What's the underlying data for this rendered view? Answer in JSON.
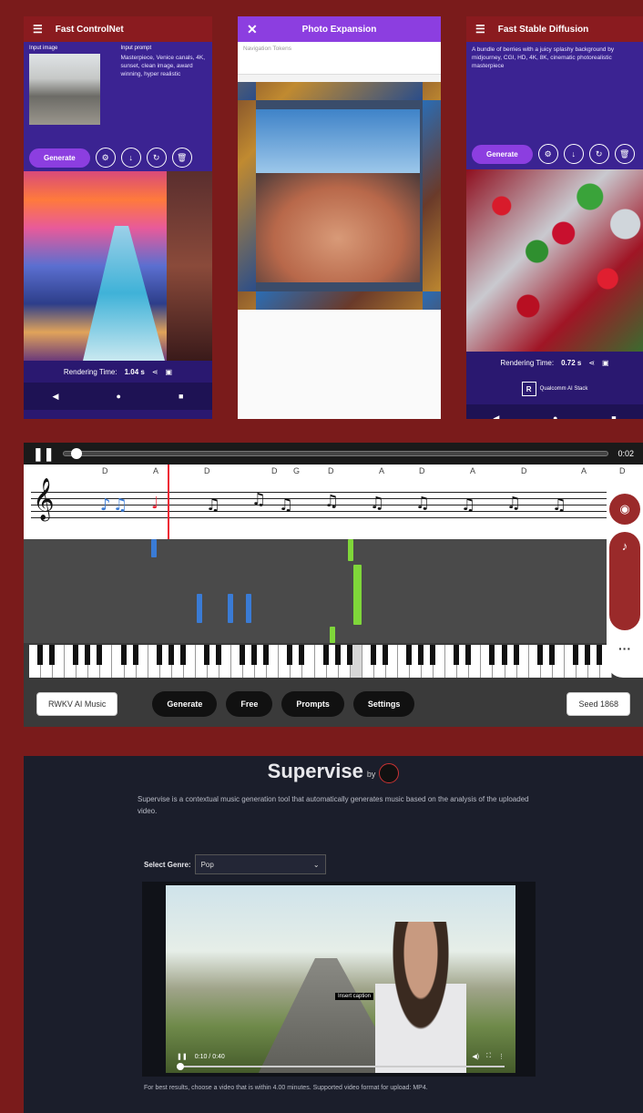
{
  "phone1": {
    "title": "Fast ControlNet",
    "input_image_label": "Input image",
    "input_prompt_label": "Input prompt",
    "prompt": "Masterpiece, Venice canals, 4K, sunset, clean image, award winning, hyper realistic",
    "generate_label": "Generate",
    "rendering_label": "Rendering Time:",
    "rendering_value": "1.04 s"
  },
  "phone2": {
    "title": "Photo Expansion",
    "field_placeholder": "Navigation Tokens"
  },
  "phone3": {
    "title": "Fast Stable Diffusion",
    "prompt": "A bundle of berries with a juicy splashy background by midjourney, CGI, HD, 4K, 8K, cinematic photorealistic masterpiece",
    "generate_label": "Generate",
    "rendering_label": "Rendering Time:",
    "rendering_value": "0.72 s",
    "logo_text": "Qualcomm AI Stack"
  },
  "music": {
    "time": "0:02",
    "chords": [
      "D",
      "A",
      "D",
      "D",
      "G",
      "D",
      "A",
      "D",
      "A",
      "D",
      "A",
      "D"
    ],
    "buttons": {
      "rwkv": "RWKV AI Music",
      "generate": "Generate",
      "free": "Free",
      "prompts": "Prompts",
      "settings": "Settings",
      "seed": "Seed 1868"
    }
  },
  "supervise": {
    "title": "Supervise",
    "by": "by",
    "description": "Supervise is a contextual music generation tool that automatically generates music based on the analysis of the uploaded video.",
    "genre_label": "Select Genre:",
    "genre_value": "Pop",
    "caption": "Insert caption",
    "time": "0:10 / 0:40",
    "note": "For best results, choose a video that is within 4.00 minutes. Supported video format for upload: MP4."
  }
}
